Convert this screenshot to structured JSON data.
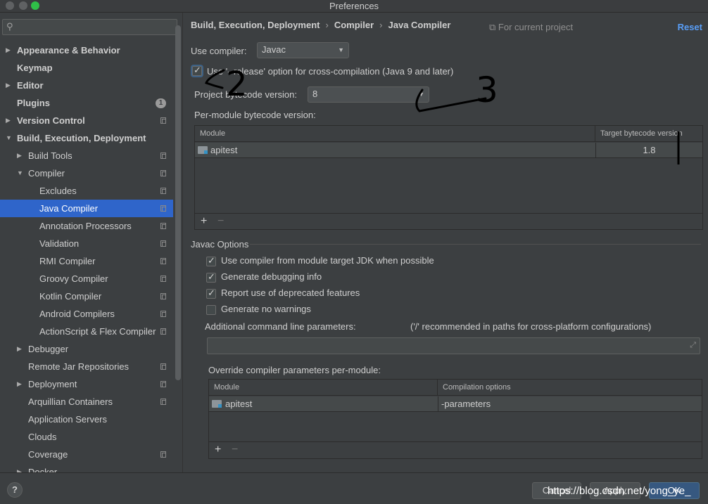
{
  "window": {
    "title": "Preferences"
  },
  "search": {
    "placeholder": ""
  },
  "sidebar": {
    "items": [
      {
        "label": "Appearance & Behavior",
        "level": 0,
        "arrow": "▶",
        "bold": true
      },
      {
        "label": "Keymap",
        "level": 0,
        "bold": true
      },
      {
        "label": "Editor",
        "level": 0,
        "arrow": "▶",
        "bold": true
      },
      {
        "label": "Plugins",
        "level": 0,
        "bold": true,
        "badge": "1"
      },
      {
        "label": "Version Control",
        "level": 0,
        "arrow": "▶",
        "bold": true,
        "copy": true
      },
      {
        "label": "Build, Execution, Deployment",
        "level": 0,
        "arrow": "▼",
        "bold": true
      },
      {
        "label": "Build Tools",
        "level": 1,
        "arrow": "▶",
        "copy": true
      },
      {
        "label": "Compiler",
        "level": 1,
        "arrow": "▼",
        "copy": true
      },
      {
        "label": "Excludes",
        "level": 2,
        "copy": true
      },
      {
        "label": "Java Compiler",
        "level": 2,
        "copy": true,
        "selected": true
      },
      {
        "label": "Annotation Processors",
        "level": 2,
        "copy": true
      },
      {
        "label": "Validation",
        "level": 2,
        "copy": true
      },
      {
        "label": "RMI Compiler",
        "level": 2,
        "copy": true
      },
      {
        "label": "Groovy Compiler",
        "level": 2,
        "copy": true
      },
      {
        "label": "Kotlin Compiler",
        "level": 2,
        "copy": true
      },
      {
        "label": "Android Compilers",
        "level": 2,
        "copy": true
      },
      {
        "label": "ActionScript & Flex Compiler",
        "level": 2,
        "copy": true
      },
      {
        "label": "Debugger",
        "level": 1,
        "arrow": "▶"
      },
      {
        "label": "Remote Jar Repositories",
        "level": 1,
        "copy": true
      },
      {
        "label": "Deployment",
        "level": 1,
        "arrow": "▶",
        "copy": true
      },
      {
        "label": "Arquillian Containers",
        "level": 1,
        "copy": true
      },
      {
        "label": "Application Servers",
        "level": 1
      },
      {
        "label": "Clouds",
        "level": 1
      },
      {
        "label": "Coverage",
        "level": 1,
        "copy": true
      },
      {
        "label": "Docker",
        "level": 1,
        "arrow": "▶"
      }
    ]
  },
  "header": {
    "breadcrumb": [
      "Build, Execution, Deployment",
      "Compiler",
      "Java Compiler"
    ],
    "scope": "For current project",
    "reset": "Reset"
  },
  "compiler": {
    "use_compiler_label": "Use compiler:",
    "use_compiler_value": "Javac",
    "release_option_label": "Use '--release' option for cross-compilation (Java 9 and later)",
    "release_option_checked": true,
    "bytecode_label": "Project bytecode version:",
    "bytecode_value": "8",
    "per_module_label": "Per-module bytecode version:",
    "module_table": {
      "columns": [
        "Module",
        "Target bytecode version"
      ],
      "rows": [
        {
          "module": "apitest",
          "version": "1.8"
        }
      ]
    }
  },
  "javac": {
    "section_title": "Javac Options",
    "options": [
      {
        "label": "Use compiler from module target JDK when possible",
        "checked": true
      },
      {
        "label": "Generate debugging info",
        "checked": true
      },
      {
        "label": "Report use of deprecated features",
        "checked": true
      },
      {
        "label": "Generate no warnings",
        "checked": false
      }
    ],
    "additional_label": "Additional command line parameters:",
    "additional_hint": "('/' recommended in paths for cross-platform configurations)",
    "additional_value": "",
    "override_label": "Override compiler parameters per-module:",
    "override_table": {
      "columns": [
        "Module",
        "Compilation options"
      ],
      "rows": [
        {
          "module": "apitest",
          "options": "-parameters"
        }
      ]
    }
  },
  "table_buttons": {
    "add": "+",
    "remove": "−"
  },
  "footer": {
    "help": "?",
    "cancel": "Cancel",
    "apply": "Apply",
    "ok": "OK",
    "watermark": "https://blog.csdn.net/yong_ye_"
  },
  "annotations": {
    "mark_2": "2",
    "mark_3": "3"
  }
}
